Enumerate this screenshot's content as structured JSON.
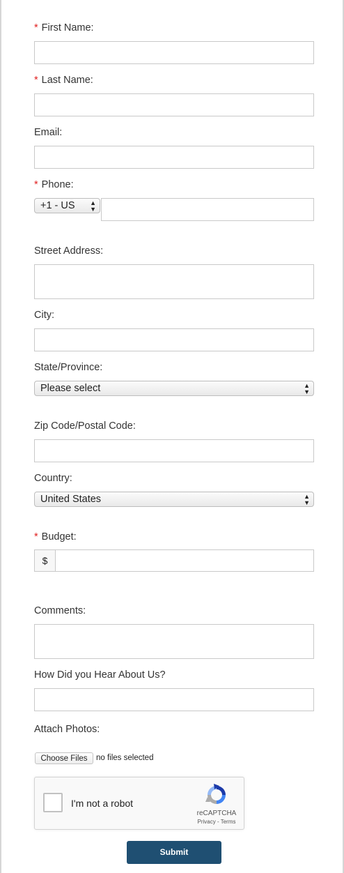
{
  "form": {
    "required_marker": "*",
    "first_name": {
      "label": "First Name:",
      "value": ""
    },
    "last_name": {
      "label": "Last Name:",
      "value": ""
    },
    "email": {
      "label": "Email:",
      "value": ""
    },
    "phone": {
      "label": "Phone:",
      "country_code": "+1 - US",
      "value": ""
    },
    "street_address": {
      "label": "Street Address:",
      "value": ""
    },
    "city": {
      "label": "City:",
      "value": ""
    },
    "state": {
      "label": "State/Province:",
      "selected": "Please select"
    },
    "zip": {
      "label": "Zip Code/Postal Code:",
      "value": ""
    },
    "country": {
      "label": "Country:",
      "selected": "United States"
    },
    "budget": {
      "label": "Budget:",
      "prefix": "$",
      "value": ""
    },
    "comments": {
      "label": "Comments:",
      "value": ""
    },
    "referral": {
      "label": "How Did you Hear About Us?",
      "value": ""
    },
    "attach": {
      "label": "Attach Photos:",
      "button": "Choose Files",
      "status": "no files selected"
    },
    "captcha": {
      "text": "I'm not a robot",
      "brand": "reCAPTCHA",
      "links": "Privacy - Terms"
    },
    "submit_label": "Submit"
  },
  "colors": {
    "required": "#e02020",
    "submit_bg": "#1f4f72",
    "input_border": "#c9c9c9",
    "frame": "#d6d6d6"
  },
  "icons": {
    "captcha_logo": "recaptcha-icon",
    "select_arrows": "updown-arrows-icon"
  }
}
